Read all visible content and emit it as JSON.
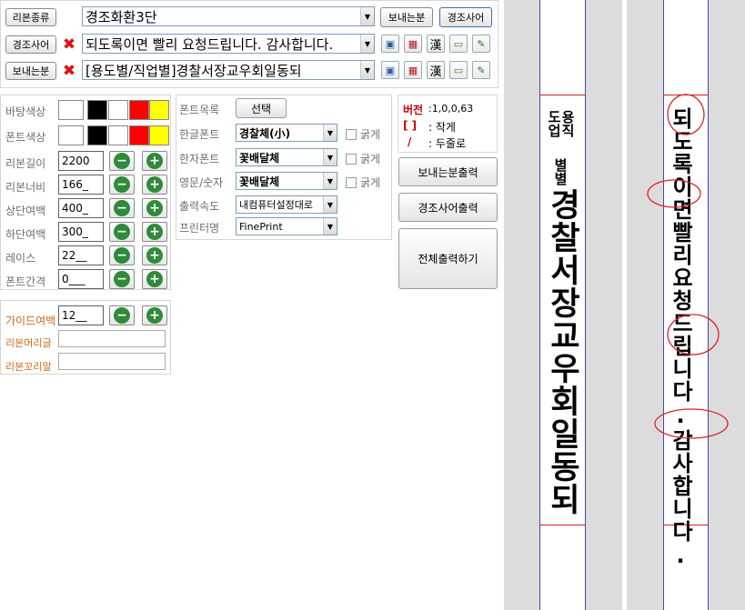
{
  "top": {
    "ribbon_type_button": "리본종류",
    "ribbon_type_value": "경조화환3단",
    "sender_button": "보내는분",
    "condolence_button": "경조사어",
    "condolence_label": "경조사어",
    "condolence_value": "되도록이면 빨리 요청드립니다. 감사합니다.",
    "sender_label": "보내는분",
    "sender_value": "[용도별/직업별]경찰서장교우회일동되"
  },
  "settings": {
    "bg_color": "바탕색상",
    "font_color": "폰트색상",
    "ribbon_length": "리본길이",
    "ribbon_length_value": "2200",
    "ribbon_width": "리본너비",
    "ribbon_width_value": "166_",
    "top_margin": "상단여백",
    "top_margin_value": "400_",
    "bottom_margin": "하단여백",
    "bottom_margin_value": "300_",
    "lace": "레이스",
    "lace_value": "22__",
    "font_spacing": "폰트간격",
    "font_spacing_value": "0___"
  },
  "guide": {
    "guide_margin": "가이드여백",
    "guide_margin_value": "12__",
    "ribbon_head": "리본머리글",
    "ribbon_tail": "리본꼬리말"
  },
  "fonts": {
    "font_list": "폰트목록",
    "select_button": "선택",
    "hangul_font": "한글폰트",
    "hangul_font_value": "경찰체(小)",
    "hanja_font": "한자폰트",
    "hanja_font_value": "꽃배달체",
    "eng_font": "영문/숫자",
    "eng_font_value": "꽃배달체",
    "bold": "굵게",
    "output_speed": "출력속도",
    "output_speed_value": "내컴퓨터설정대로",
    "printer": "프린터명",
    "printer_value": "FinePrint"
  },
  "info": {
    "version_label": "버전",
    "version_value": ":1,0,0,63",
    "bracket_sym": "[ ]",
    "bracket_desc": ": 작게",
    "slash_sym": "/",
    "slash_desc": ": 두줄로"
  },
  "actions": {
    "print_sender": "보내는분출력",
    "print_condolence": "경조사어출력",
    "print_all": "전체출력하기"
  },
  "preview": {
    "left_small_col1": "용직",
    "left_small_col2": "도업",
    "left_small_col3": "별별",
    "left_main": "경찰서장교우회일동되",
    "right_main": "되도록이면빨리요청드립니다.감사합니다."
  },
  "colors": {
    "red": "#ff0000",
    "yellow": "#ffff00",
    "black": "#000000",
    "version_red": "#cc0000"
  }
}
